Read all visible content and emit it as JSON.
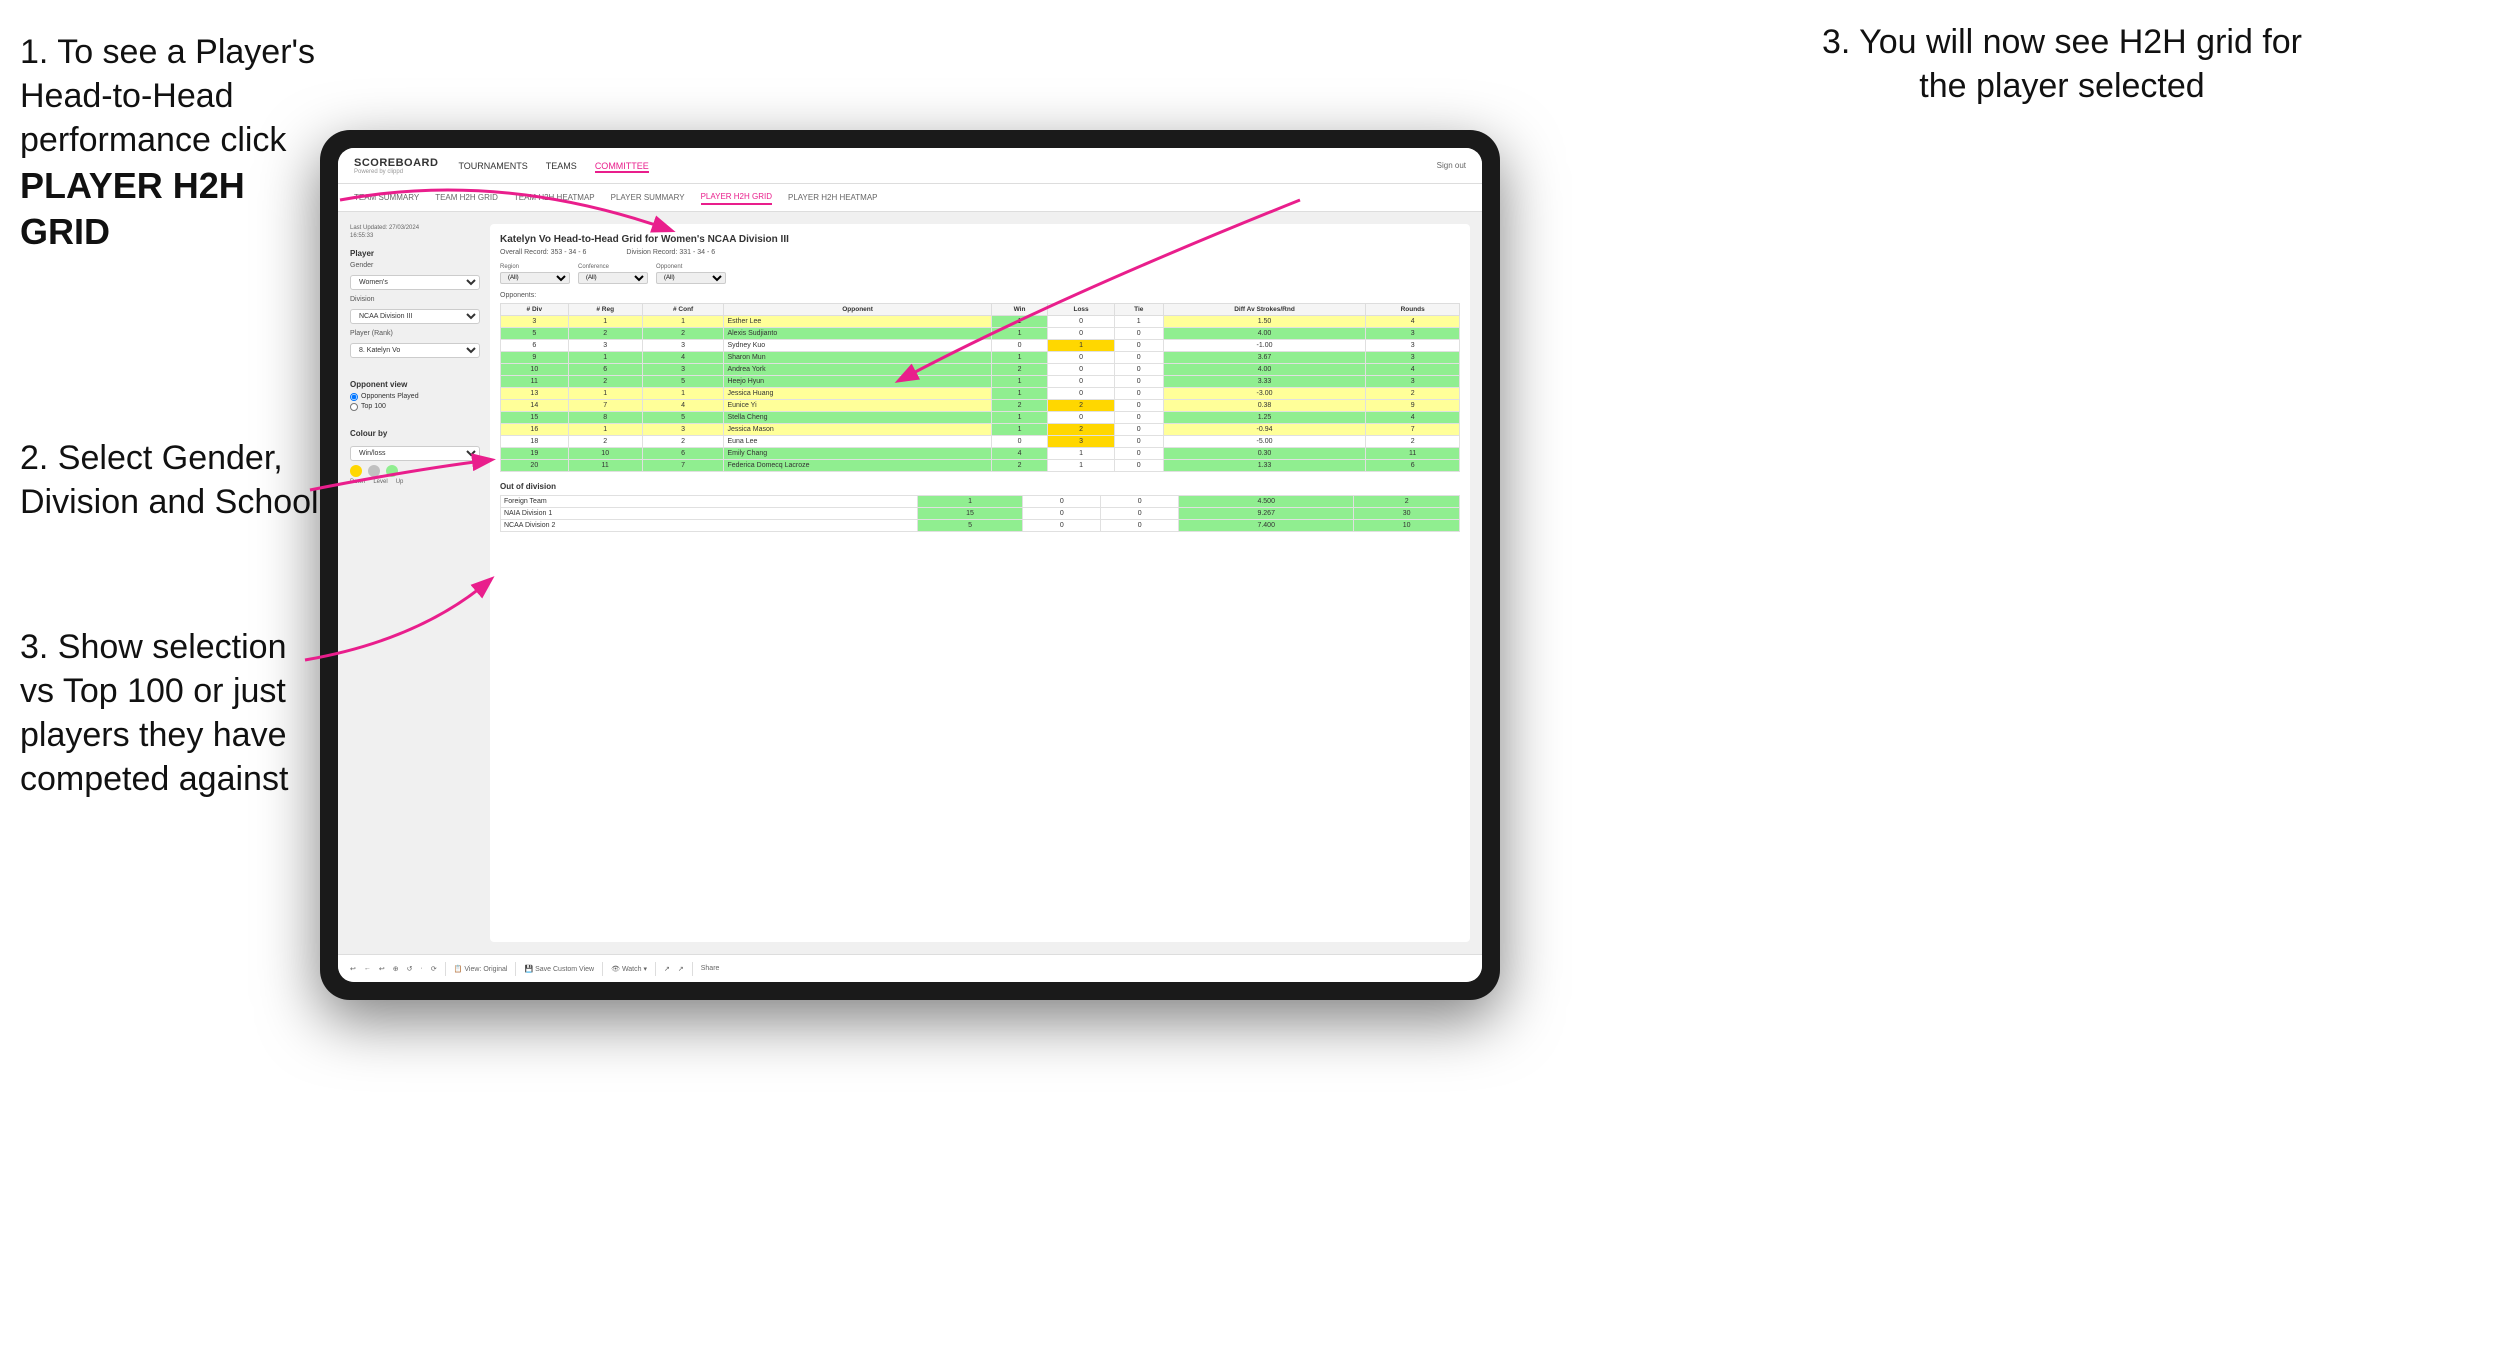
{
  "instructions": {
    "step1": {
      "text": "1. To see a Player's Head-to-Head performance click",
      "bold": "PLAYER H2H GRID"
    },
    "step2": {
      "text": "2. Select Gender, Division and School"
    },
    "step3_left": {
      "text": "3. Show selection vs Top 100 or just players they have competed against"
    },
    "step3_right": {
      "text": "3. You will now see H2H grid for the player selected"
    }
  },
  "app": {
    "logo": "SCOREBOARD",
    "powered_by": "Powered by clippd",
    "nav_items": [
      "TOURNAMENTS",
      "TEAMS",
      "COMMITTEE"
    ],
    "active_nav": "COMMITTEE",
    "header_right": "Sign out",
    "sub_nav": [
      "TEAM SUMMARY",
      "TEAM H2H GRID",
      "TEAM H2H HEATMAP",
      "PLAYER SUMMARY",
      "PLAYER H2H GRID",
      "PLAYER H2H HEATMAP"
    ],
    "active_sub_nav": "PLAYER H2H GRID"
  },
  "left_panel": {
    "last_updated_label": "Last Updated: 27/03/2024",
    "last_updated_time": "16:55:33",
    "player_label": "Player",
    "gender_label": "Gender",
    "gender_value": "Women's",
    "division_label": "Division",
    "division_value": "NCAA Division III",
    "player_rank_label": "Player (Rank)",
    "player_rank_value": "8. Katelyn Vo",
    "opponent_view_label": "Opponent view",
    "radio1_label": "Opponents Played",
    "radio2_label": "Top 100",
    "colour_by_label": "Colour by",
    "colour_by_value": "Win/loss",
    "colours": [
      {
        "color": "#FFD700",
        "label": "Down"
      },
      {
        "color": "#C0C0C0",
        "label": "Level"
      },
      {
        "color": "#90EE90",
        "label": "Up"
      }
    ]
  },
  "grid": {
    "title": "Katelyn Vo Head-to-Head Grid for Women's NCAA Division III",
    "overall_record_label": "Overall Record:",
    "overall_record": "353 - 34 - 6",
    "division_record_label": "Division Record:",
    "division_record": "331 - 34 - 6",
    "region_label": "Region",
    "conference_label": "Conference",
    "opponent_label": "Opponent",
    "opponents_label": "Opponents:",
    "region_filter": "(All)",
    "conference_filter": "(All)",
    "opponent_filter": "(All)",
    "columns": [
      "# Div",
      "# Reg",
      "# Conf",
      "Opponent",
      "Win",
      "Loss",
      "Tie",
      "Diff Av Strokes/Rnd",
      "Rounds"
    ],
    "rows": [
      {
        "div": "3",
        "reg": "1",
        "conf": "1",
        "opponent": "Esther Lee",
        "win": 1,
        "loss": 0,
        "tie": 1,
        "diff": "1.50",
        "rounds": 4,
        "color": "yellow"
      },
      {
        "div": "5",
        "reg": "2",
        "conf": "2",
        "opponent": "Alexis Sudjianto",
        "win": 1,
        "loss": 0,
        "tie": 0,
        "diff": "4.00",
        "rounds": 3,
        "color": "green"
      },
      {
        "div": "6",
        "reg": "3",
        "conf": "3",
        "opponent": "Sydney Kuo",
        "win": 0,
        "loss": 1,
        "tie": 0,
        "diff": "-1.00",
        "rounds": 3,
        "color": "white"
      },
      {
        "div": "9",
        "reg": "1",
        "conf": "4",
        "opponent": "Sharon Mun",
        "win": 1,
        "loss": 0,
        "tie": 0,
        "diff": "3.67",
        "rounds": 3,
        "color": "green"
      },
      {
        "div": "10",
        "reg": "6",
        "conf": "3",
        "opponent": "Andrea York",
        "win": 2,
        "loss": 0,
        "tie": 0,
        "diff": "4.00",
        "rounds": 4,
        "color": "green"
      },
      {
        "div": "11",
        "reg": "2",
        "conf": "5",
        "opponent": "Heejo Hyun",
        "win": 1,
        "loss": 0,
        "tie": 0,
        "diff": "3.33",
        "rounds": 3,
        "color": "green"
      },
      {
        "div": "13",
        "reg": "1",
        "conf": "1",
        "opponent": "Jessica Huang",
        "win": 1,
        "loss": 0,
        "tie": 0,
        "diff": "-3.00",
        "rounds": 2,
        "color": "yellow"
      },
      {
        "div": "14",
        "reg": "7",
        "conf": "4",
        "opponent": "Eunice Yi",
        "win": 2,
        "loss": 2,
        "tie": 0,
        "diff": "0.38",
        "rounds": 9,
        "color": "yellow"
      },
      {
        "div": "15",
        "reg": "8",
        "conf": "5",
        "opponent": "Stella Cheng",
        "win": 1,
        "loss": 0,
        "tie": 0,
        "diff": "1.25",
        "rounds": 4,
        "color": "green"
      },
      {
        "div": "16",
        "reg": "1",
        "conf": "3",
        "opponent": "Jessica Mason",
        "win": 1,
        "loss": 2,
        "tie": 0,
        "diff": "-0.94",
        "rounds": 7,
        "color": "yellow"
      },
      {
        "div": "18",
        "reg": "2",
        "conf": "2",
        "opponent": "Euna Lee",
        "win": 0,
        "loss": 3,
        "tie": 0,
        "diff": "-5.00",
        "rounds": 2,
        "color": "white"
      },
      {
        "div": "19",
        "reg": "10",
        "conf": "6",
        "opponent": "Emily Chang",
        "win": 4,
        "loss": 1,
        "tie": 0,
        "diff": "0.30",
        "rounds": 11,
        "color": "green"
      },
      {
        "div": "20",
        "reg": "11",
        "conf": "7",
        "opponent": "Federica Domecq Lacroze",
        "win": 2,
        "loss": 1,
        "tie": 0,
        "diff": "1.33",
        "rounds": 6,
        "color": "green"
      }
    ],
    "out_of_division_label": "Out of division",
    "out_of_division_rows": [
      {
        "name": "Foreign Team",
        "win": 1,
        "loss": 0,
        "tie": 0,
        "diff": "4.500",
        "rounds": 2,
        "color": "green"
      },
      {
        "name": "NAIA Division 1",
        "win": 15,
        "loss": 0,
        "tie": 0,
        "diff": "9.267",
        "rounds": 30,
        "color": "green"
      },
      {
        "name": "NCAA Division 2",
        "win": 5,
        "loss": 0,
        "tie": 0,
        "diff": "7.400",
        "rounds": 10,
        "color": "green"
      }
    ]
  },
  "toolbar": {
    "buttons": [
      "↩",
      "←",
      "↩",
      "⊕",
      "↺",
      "·",
      "⟳",
      "View: Original",
      "Save Custom View",
      "Watch ▾",
      "↗",
      "↗",
      "Share"
    ]
  }
}
